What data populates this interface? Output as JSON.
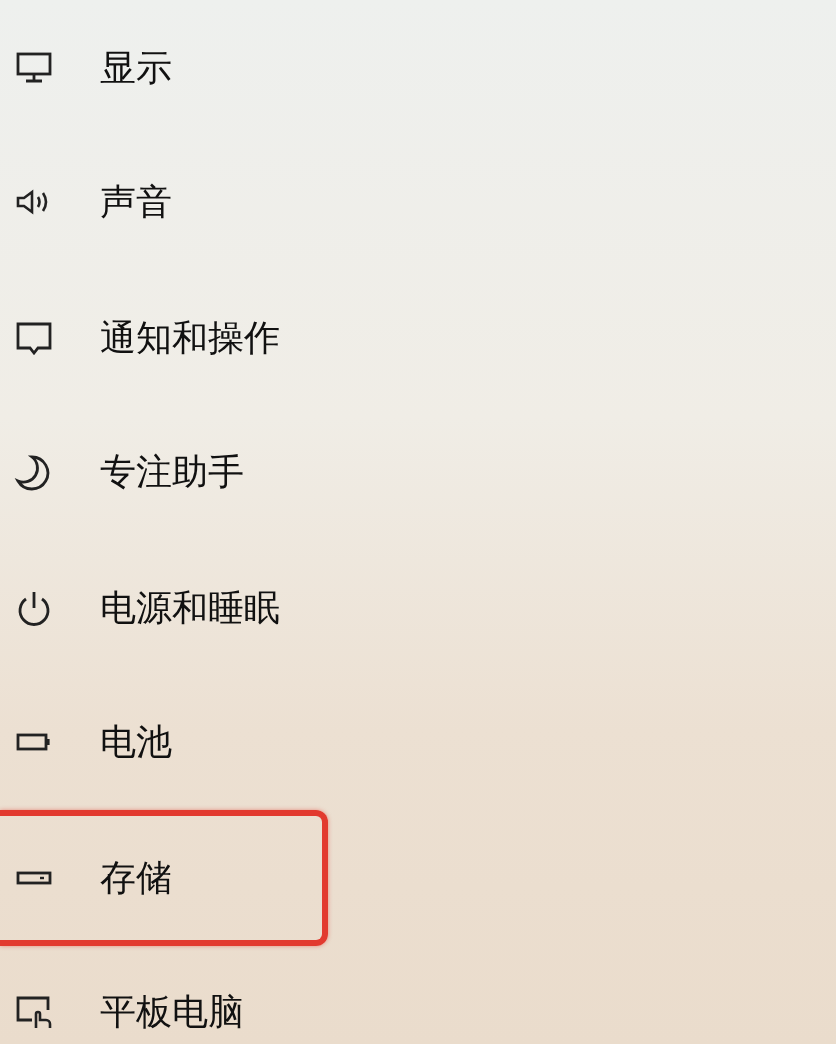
{
  "items": [
    {
      "kind": "display",
      "label": "显示",
      "highlighted": false
    },
    {
      "kind": "sound",
      "label": "声音",
      "highlighted": false
    },
    {
      "kind": "notifications",
      "label": "通知和操作",
      "highlighted": false
    },
    {
      "kind": "focus",
      "label": "专注助手",
      "highlighted": false
    },
    {
      "kind": "power",
      "label": "电源和睡眠",
      "highlighted": false
    },
    {
      "kind": "battery",
      "label": "电池",
      "highlighted": false
    },
    {
      "kind": "storage",
      "label": "存储",
      "highlighted": true
    },
    {
      "kind": "tablet",
      "label": "平板电脑",
      "highlighted": false
    }
  ]
}
